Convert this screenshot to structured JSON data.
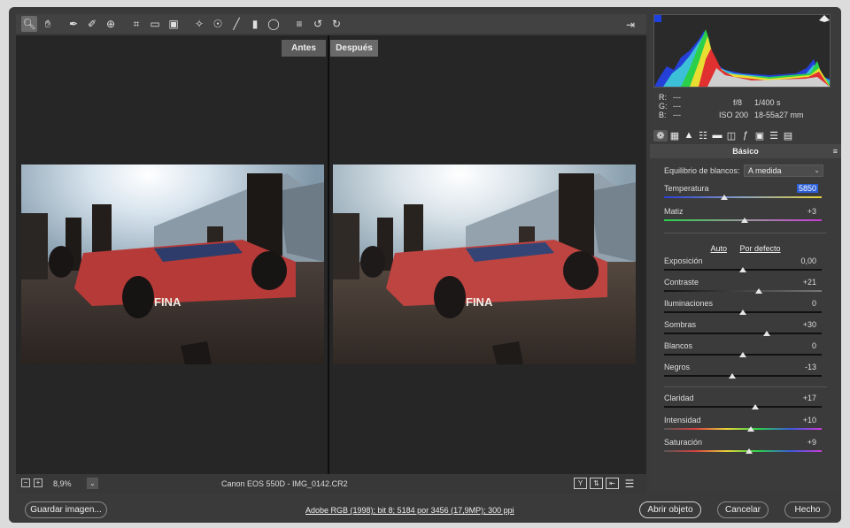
{
  "preview": {
    "before_label": "Antes",
    "after_label": "Después"
  },
  "statusbar": {
    "zoom_minus": "−",
    "zoom_plus": "+",
    "zoom": "8,9%",
    "camera_file": "Canon EOS 550D  -  IMG_0142.CR2"
  },
  "readout": {
    "r_label": "R:",
    "r_value": "---",
    "g_label": "G:",
    "g_value": "---",
    "b_label": "B:",
    "b_value": "---",
    "aperture": "f/8",
    "shutter": "1/400 s",
    "iso": "ISO 200",
    "lens": "18-55a27 mm"
  },
  "panel": {
    "title": "Básico",
    "wb_label": "Equilibrio de blancos:",
    "wb_value": "A medida",
    "auto_link": "Auto",
    "default_link": "Por defecto",
    "sliders": [
      {
        "label": "Temperatura",
        "value": "5850",
        "level": 0.38
      },
      {
        "label": "Matiz",
        "value": "+3",
        "level": 0.51
      },
      {
        "label": "Exposición",
        "value": "0,00",
        "level": 0.5
      },
      {
        "label": "Contraste",
        "value": "+21",
        "level": 0.6
      },
      {
        "label": "Iluminaciones",
        "value": "0",
        "level": 0.5
      },
      {
        "label": "Sombras",
        "value": "+30",
        "level": 0.65
      },
      {
        "label": "Blancos",
        "value": "0",
        "level": 0.5
      },
      {
        "label": "Negros",
        "value": "-13",
        "level": 0.43
      },
      {
        "label": "Claridad",
        "value": "+17",
        "level": 0.58
      },
      {
        "label": "Intensidad",
        "value": "+10",
        "level": 0.55
      },
      {
        "label": "Saturación",
        "value": "+9",
        "level": 0.54
      }
    ]
  },
  "footer": {
    "save_label": "Guardar imagen...",
    "color_info": "Adobe RGB (1998); bit 8; 5184 por 3456 (17,9MP); 300 ppi",
    "open_label": "Abrir objeto",
    "cancel_label": "Cancelar",
    "done_label": "Hecho"
  },
  "colors": {
    "selection": "#2d5fd6",
    "panel_bg": "#3b3b3b",
    "preview_bg": "#262626"
  }
}
